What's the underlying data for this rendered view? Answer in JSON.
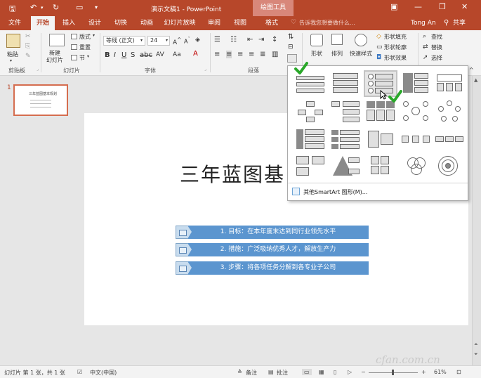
{
  "titlebar": {
    "save_icon": "save-icon",
    "undo_icon": "undo-icon",
    "redo_icon": "redo-icon",
    "start_icon": "start-from-beginning-icon",
    "customize_icon": "customize-quick-access-icon",
    "title": "演示文稿1 - PowerPoint",
    "context_label": "绘图工具",
    "ribbon_display_icon": "ribbon-display-options-icon",
    "minimize_icon": "minimize-icon",
    "restore_icon": "restore-icon",
    "close_icon": "close-icon"
  },
  "tabs": [
    {
      "label": "文件"
    },
    {
      "label": "开始"
    },
    {
      "label": "插入"
    },
    {
      "label": "设计"
    },
    {
      "label": "切换"
    },
    {
      "label": "动画"
    },
    {
      "label": "幻灯片放映"
    },
    {
      "label": "审阅"
    },
    {
      "label": "视图"
    },
    {
      "label": "格式"
    }
  ],
  "search_placeholder": "告诉我您想要做什么...",
  "user_name": "Tong An",
  "share_label": "共享",
  "ribbon": {
    "paste": "粘贴",
    "clipboard": "剪贴板",
    "new_slide": "新建",
    "new_slide2": "幻灯片",
    "layout": "版式",
    "reset": "重置",
    "section": "节",
    "slides": "幻灯片",
    "font_name": "等线 (正文)",
    "font_size": "24",
    "font": "字体",
    "paragraph": "段落",
    "shape": "形状",
    "arrange": "排列",
    "quick_styles": "快速样式",
    "shape_fill": "形状填充",
    "shape_outline": "形状轮廓",
    "shape_effects": "形状效果",
    "find": "查找",
    "replace": "替换",
    "select": "选择"
  },
  "slide": {
    "number": "1",
    "thumb_title": "三年蓝图基本规划",
    "title": "三年蓝图基",
    "bullets": [
      "1. 目标：在本年度末达到同行业领先水平",
      "2. 措施：广泛吸纳优秀人才，解放生产力",
      "3. 步骤：将各项任务分解到各专业子公司"
    ]
  },
  "gallery": {
    "more_label": "其他SmartArt 图形(M)..."
  },
  "status": {
    "slide_info": "幻灯片 第 1 张，共 1 张",
    "language": "中文(中国)",
    "notes": "备注",
    "comments": "批注",
    "zoom": "61%"
  },
  "watermark": "cfan.com.cn"
}
